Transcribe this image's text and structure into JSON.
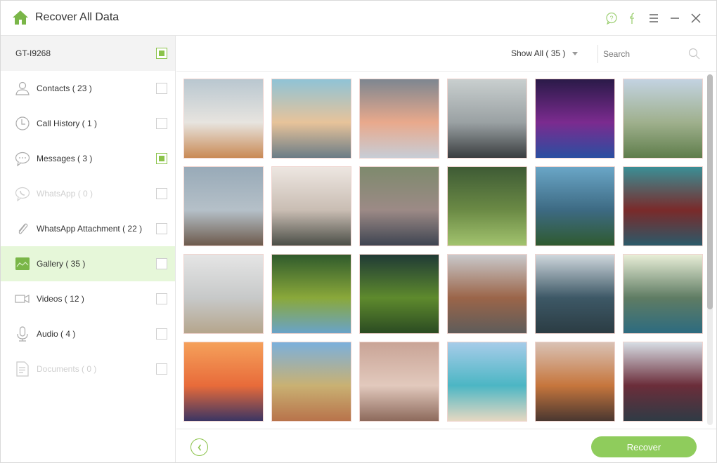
{
  "app": {
    "title": "Recover All Data",
    "accent_color": "#8bc34a",
    "icons": [
      "home-icon",
      "help-chat-icon",
      "facebook-icon",
      "menu-icon",
      "minimize-icon",
      "close-icon"
    ]
  },
  "sidebar": {
    "device": {
      "name": "GT-I9268",
      "checked": true
    },
    "categories": [
      {
        "id": "contacts",
        "label": "Contacts ( 23 )",
        "icon": "contact-icon",
        "checked": false,
        "active": false,
        "disabled": false
      },
      {
        "id": "call-history",
        "label": "Call History ( 1 )",
        "icon": "clock-icon",
        "checked": false,
        "active": false,
        "disabled": false
      },
      {
        "id": "messages",
        "label": "Messages ( 3 )",
        "icon": "message-icon",
        "checked": true,
        "active": false,
        "disabled": false
      },
      {
        "id": "whatsapp",
        "label": "WhatsApp ( 0 )",
        "icon": "whatsapp-icon",
        "checked": false,
        "active": false,
        "disabled": true
      },
      {
        "id": "whatsapp-attachment",
        "label": "WhatsApp Attachment ( 22 )",
        "icon": "paperclip-icon",
        "checked": false,
        "active": false,
        "disabled": false
      },
      {
        "id": "gallery",
        "label": "Gallery ( 35 )",
        "icon": "gallery-icon",
        "checked": false,
        "active": true,
        "disabled": false
      },
      {
        "id": "videos",
        "label": "Videos ( 12 )",
        "icon": "video-camera-icon",
        "checked": false,
        "active": false,
        "disabled": false
      },
      {
        "id": "audio",
        "label": "Audio ( 4 )",
        "icon": "microphone-icon",
        "checked": false,
        "active": false,
        "disabled": false
      },
      {
        "id": "documents",
        "label": "Documents ( 0 )",
        "icon": "document-icon",
        "checked": false,
        "active": false,
        "disabled": true
      }
    ]
  },
  "toolbar": {
    "filter_label": "Show All ( 35 )",
    "search_placeholder": "Search",
    "search_value": ""
  },
  "gallery": {
    "photos": [
      {
        "subject": "modern house exterior",
        "colors": [
          "#b9c7d0",
          "#e7e4df",
          "#c98a55"
        ]
      },
      {
        "subject": "person on cliff at sunset",
        "colors": [
          "#8fc3d6",
          "#e7c39a",
          "#6b7c86"
        ]
      },
      {
        "subject": "desert dunes at dusk",
        "colors": [
          "#7d8690",
          "#e9a98c",
          "#c7cdd6"
        ]
      },
      {
        "subject": "city skyline with tower",
        "colors": [
          "#c9cfcf",
          "#9aa1a3",
          "#3a3d40"
        ]
      },
      {
        "subject": "neon skyscrapers at night",
        "colors": [
          "#2a1a48",
          "#7b2b8f",
          "#2a4fa1"
        ]
      },
      {
        "subject": "aerial river and city",
        "colors": [
          "#c3d3e2",
          "#9fb08d",
          "#5f7d4b"
        ]
      },
      {
        "subject": "family at beach",
        "colors": [
          "#98aab8",
          "#b5c0c8",
          "#6d5a4c"
        ]
      },
      {
        "subject": "people in living room",
        "colors": [
          "#ede6e1",
          "#c9bdb3",
          "#4b4e47"
        ]
      },
      {
        "subject": "group of friends outdoors",
        "colors": [
          "#7e8a6d",
          "#9c8a86",
          "#3e4451"
        ]
      },
      {
        "subject": "family picnic on grass",
        "colors": [
          "#3e5b35",
          "#6b8a45",
          "#a2c36e"
        ]
      },
      {
        "subject": "mountain forest landscape",
        "colors": [
          "#6aa6c7",
          "#3d6a83",
          "#2f5a2f"
        ]
      },
      {
        "subject": "superhero movie poster",
        "colors": [
          "#3a8f96",
          "#7a2a2a",
          "#2b5a6a"
        ]
      },
      {
        "subject": "family looking at sea",
        "colors": [
          "#e5e5e5",
          "#c7c9c9",
          "#b5a58c"
        ]
      },
      {
        "subject": "arched bridge reflection",
        "colors": [
          "#2f5a2c",
          "#8aa83a",
          "#69a3c9"
        ]
      },
      {
        "subject": "green rice terraces",
        "colors": [
          "#1f3a35",
          "#5e8a2d",
          "#2b4b22"
        ]
      },
      {
        "subject": "mountain road",
        "colors": [
          "#c9c9cb",
          "#9b6549",
          "#5e5c5a"
        ]
      },
      {
        "subject": "winding river aerial",
        "colors": [
          "#cfd7dd",
          "#3d5866",
          "#2b3c43"
        ]
      },
      {
        "subject": "karst lake reflection",
        "colors": [
          "#e8eed7",
          "#5f7c63",
          "#2d6b80"
        ]
      },
      {
        "subject": "hot air balloons at sunset",
        "colors": [
          "#f5a15b",
          "#e86b3a",
          "#3b3563"
        ]
      },
      {
        "subject": "dirt road in savanna",
        "colors": [
          "#7bb0dc",
          "#c9b173",
          "#b8734b"
        ]
      },
      {
        "subject": "baby feet in hands",
        "colors": [
          "#c9a496",
          "#e2c9bd",
          "#8d6a5c"
        ]
      },
      {
        "subject": "father and child at beach",
        "colors": [
          "#a7cce9",
          "#4cb6c4",
          "#e6d8c2"
        ]
      },
      {
        "subject": "child reading picture book",
        "colors": [
          "#d9c2b5",
          "#c6763d",
          "#4a3730"
        ]
      },
      {
        "subject": "parent hugging toddler",
        "colors": [
          "#d7dde4",
          "#6b2d3a",
          "#2f3b45"
        ]
      }
    ]
  },
  "scroll": {
    "position_fraction": 0.0,
    "visible_fraction": 0.67
  },
  "footer": {
    "back_label": "‹",
    "recover_label": "Recover"
  }
}
